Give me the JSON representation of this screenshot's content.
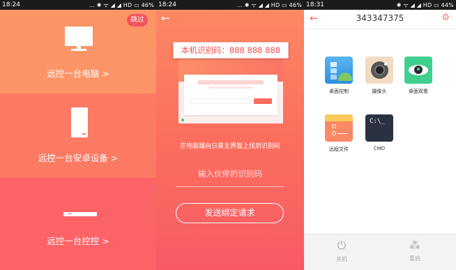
{
  "status": {
    "p1_time": "18:24",
    "p1_right": "... ✱ ᯤ ◢ ◢ HD ▭ 46%",
    "p2_time": "18:24",
    "p2_right": "... ✱ ᯤ ◢ ◢ HD ▭ 46%",
    "p3_time": "18:31",
    "p3_right": "✱ ᯤ ◢ ◢ HD ▭ 44%"
  },
  "panel1": {
    "skip_label": "跳过",
    "items": [
      {
        "label": "远控一台电脑 >",
        "icon": "monitor-icon"
      },
      {
        "label": "远控一台安卓设备 >",
        "icon": "phone-icon"
      },
      {
        "label": "远控一台控控 >",
        "icon": "remote-box-icon"
      }
    ]
  },
  "panel2": {
    "back_icon": "←",
    "code_label": "本机识别码：888 888 888",
    "hint": "在电脑端向日葵主界面上找到识别码",
    "partner_placeholder": "输入伙伴的识别码",
    "send_label": "发送绑定请求"
  },
  "panel3": {
    "back_icon": "←",
    "title": "343347375",
    "gear_icon": "⚙",
    "tiles": [
      {
        "label": "桌面控制",
        "icon": "desktop-control-icon"
      },
      {
        "label": "摄像头",
        "icon": "camera-icon"
      },
      {
        "label": "桌面观看",
        "icon": "desktop-view-icon"
      },
      {
        "label": "远程文件",
        "icon": "remote-file-icon"
      },
      {
        "label": "CMD",
        "icon": "cmd-icon",
        "glyph": "C:\\_"
      }
    ],
    "shutdown_label": "关机",
    "shutdown_icon": "⏻",
    "restart_label": "重启",
    "restart_icon": "⁂"
  },
  "colors": {
    "orange": "#fd9466",
    "coral": "#fc7a63",
    "red": "#fb6367",
    "accent": "#fb6a5d"
  }
}
